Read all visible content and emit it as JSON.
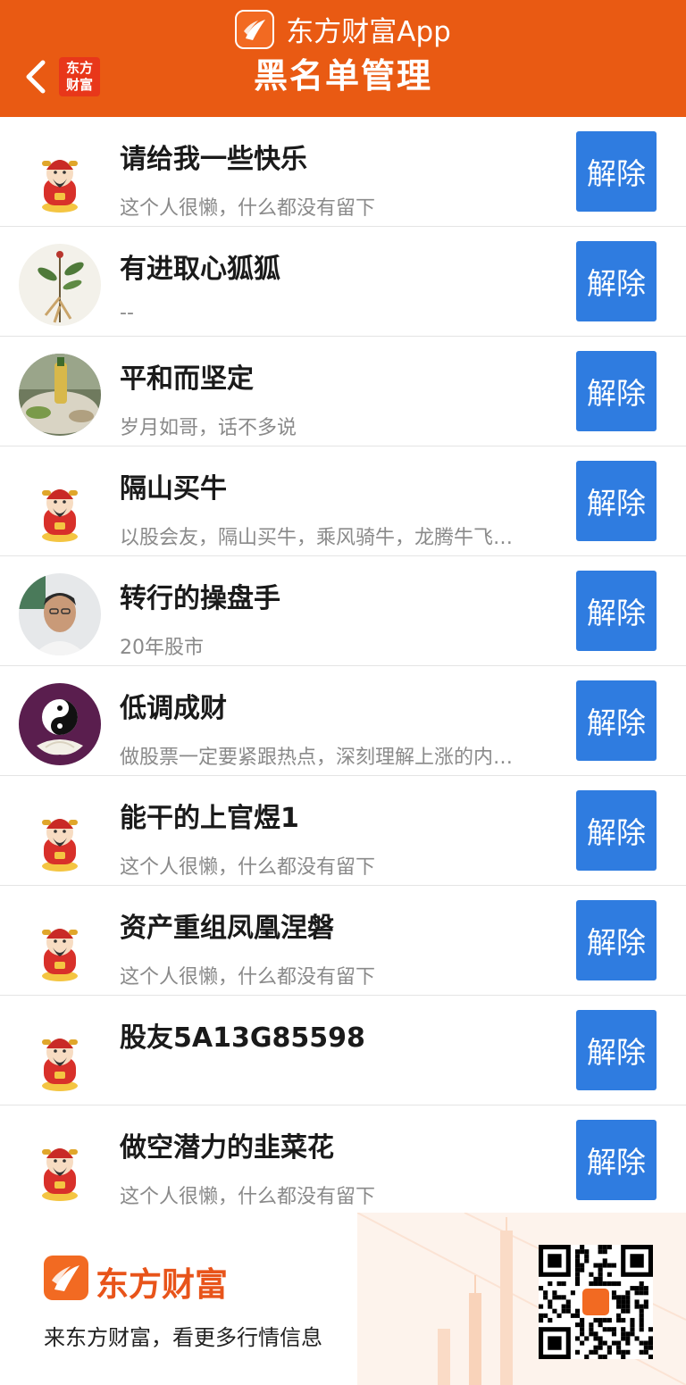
{
  "header": {
    "app_name": "东方财富App",
    "title": "黑名单管理",
    "brand_badge": [
      "东方",
      "财富"
    ],
    "color": "#e95a13"
  },
  "list": [
    {
      "name": "请给我一些快乐",
      "signature": "这个人很懒，什么都没有留下",
      "avatar": "god-of-wealth-avatar",
      "action": "解除"
    },
    {
      "name": "有进取心狐狐",
      "signature": "--",
      "avatar": "ginseng-plant-avatar",
      "action": "解除"
    },
    {
      "name": "平和而坚定",
      "signature": "岁月如哥，话不多说",
      "avatar": "dinner-table-photo-avatar",
      "action": "解除"
    },
    {
      "name": "隔山买牛",
      "signature": "以股会友，隔山买牛，乘风骑牛，龙腾牛飞…",
      "avatar": "god-of-wealth-avatar",
      "action": "解除"
    },
    {
      "name": "转行的操盘手",
      "signature": "20年股市",
      "avatar": "man-portrait-avatar",
      "action": "解除"
    },
    {
      "name": "低调成财",
      "signature": "做股票一定要紧跟热点，深刻理解上涨的内…",
      "avatar": "yin-yang-lotus-avatar",
      "action": "解除"
    },
    {
      "name": "能干的上官煜1",
      "signature": "这个人很懒，什么都没有留下",
      "avatar": "god-of-wealth-avatar",
      "action": "解除"
    },
    {
      "name": "资产重组凤凰涅磐",
      "signature": "这个人很懒，什么都没有留下",
      "avatar": "god-of-wealth-avatar",
      "action": "解除"
    },
    {
      "name": "股友5A13G85598",
      "signature": "",
      "avatar": "god-of-wealth-avatar",
      "action": "解除"
    },
    {
      "name": "做空潜力的韭菜花",
      "signature": "这个人很懒，什么都没有留下",
      "avatar": "god-of-wealth-avatar",
      "action": "解除"
    }
  ],
  "footer": {
    "brand": "东方财富",
    "tagline": "来东方财富，看更多行情信息"
  },
  "colors": {
    "accent": "#e95a13",
    "button": "#2f7ce0",
    "brand_text": "#e8541a"
  }
}
